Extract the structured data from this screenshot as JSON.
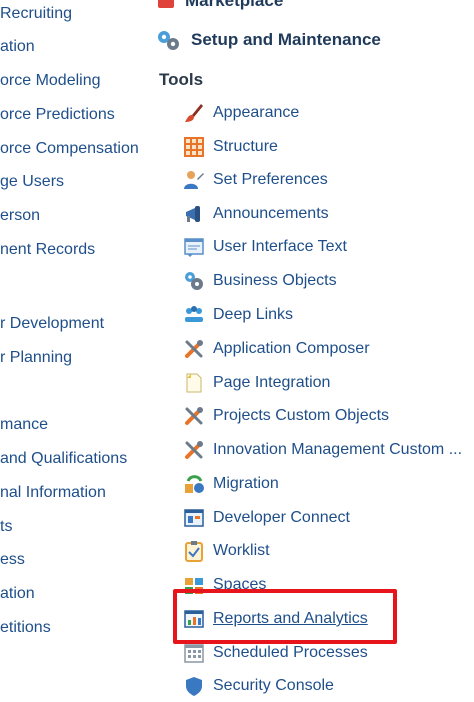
{
  "left_nav": [
    "Recruiting",
    "ation",
    "orce Modeling",
    "orce Predictions",
    "orce Compensation",
    "ge Users",
    "erson",
    "nent Records",
    "r Development",
    "r Planning",
    "mance",
    "and Qualifications",
    "nal Information",
    "ts",
    "ess",
    "ation",
    "etitions"
  ],
  "top_clipped": "Marketplace",
  "setup_section": {
    "label": "Setup and Maintenance",
    "icon": "gears-icon"
  },
  "tools": {
    "heading": "Tools",
    "items": [
      {
        "label": "Appearance",
        "icon": "paintbrush-icon"
      },
      {
        "label": "Structure",
        "icon": "grid-icon"
      },
      {
        "label": "Set Preferences",
        "icon": "user-preferences-icon"
      },
      {
        "label": "Announcements",
        "icon": "megaphone-icon"
      },
      {
        "label": "User Interface Text",
        "icon": "text-window-icon"
      },
      {
        "label": "Business Objects",
        "icon": "gears-icon"
      },
      {
        "label": "Deep Links",
        "icon": "people-link-icon"
      },
      {
        "label": "Application Composer",
        "icon": "tools-icon"
      },
      {
        "label": "Page Integration",
        "icon": "page-icon"
      },
      {
        "label": "Projects Custom Objects",
        "icon": "tools-icon"
      },
      {
        "label": "Innovation Management Custom ...",
        "icon": "tools-icon"
      },
      {
        "label": "Migration",
        "icon": "migration-icon"
      },
      {
        "label": "Developer Connect",
        "icon": "developer-window-icon"
      },
      {
        "label": "Worklist",
        "icon": "clipboard-check-icon"
      },
      {
        "label": "Spaces",
        "icon": "spaces-icon"
      },
      {
        "label": "Reports and Analytics",
        "icon": "report-chart-icon"
      },
      {
        "label": "Scheduled Processes",
        "icon": "calendar-grid-icon"
      },
      {
        "label": "Security Console",
        "icon": "security-icon"
      }
    ]
  },
  "colors": {
    "link": "#1f4f8a",
    "heading": "#1f3a5a",
    "highlight_box": "#e8141c"
  }
}
